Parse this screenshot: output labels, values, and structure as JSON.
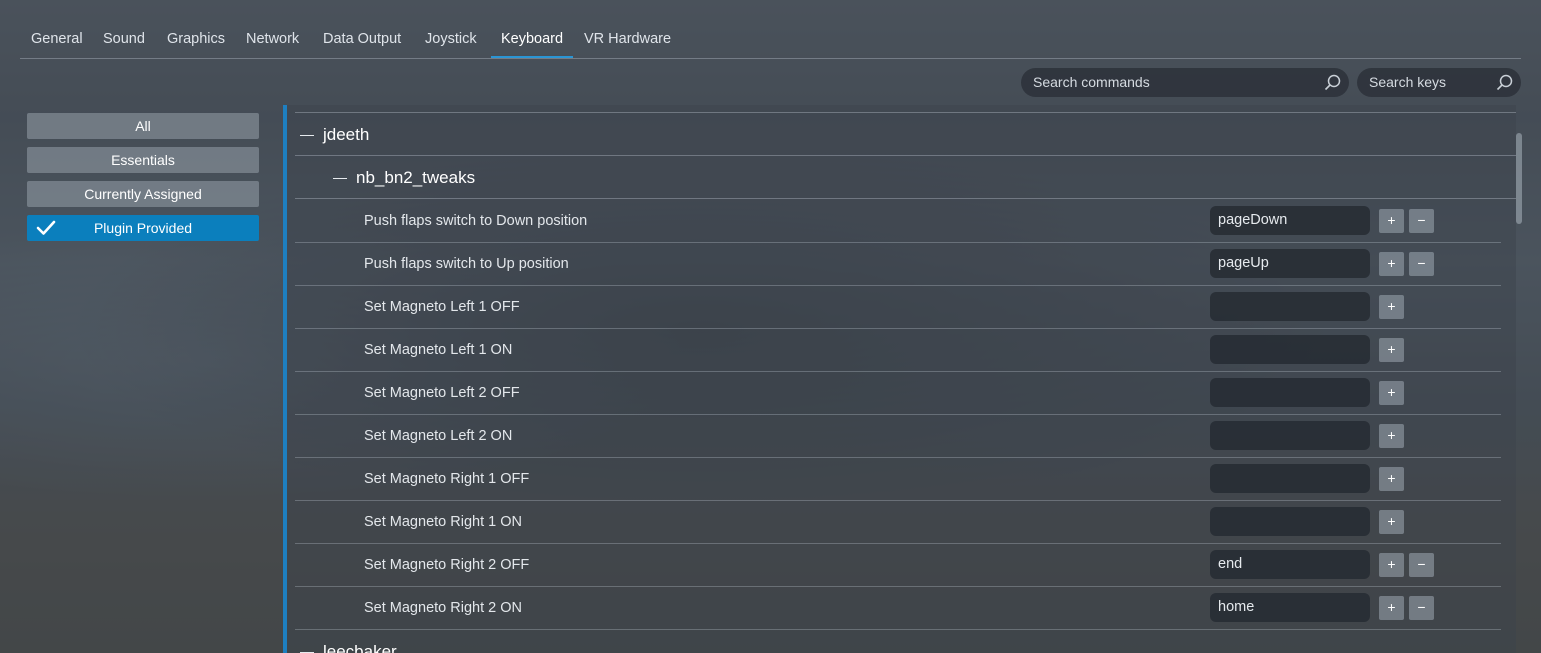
{
  "tabs": [
    {
      "label": "General"
    },
    {
      "label": "Sound"
    },
    {
      "label": "Graphics"
    },
    {
      "label": "Network"
    },
    {
      "label": "Data Output"
    },
    {
      "label": "Joystick"
    },
    {
      "label": "Keyboard",
      "active": true
    },
    {
      "label": "VR Hardware"
    }
  ],
  "search": {
    "commands_placeholder": "Search commands",
    "keys_placeholder": "Search keys"
  },
  "filters": [
    {
      "label": "All"
    },
    {
      "label": "Essentials"
    },
    {
      "label": "Currently Assigned"
    },
    {
      "label": "Plugin Provided",
      "active": true
    }
  ],
  "groups": {
    "jdeeth": "jdeeth",
    "nb_bn2_tweaks": "nb_bn2_tweaks",
    "leecbaker": "leecbaker"
  },
  "commands": [
    {
      "label": "Push flaps switch to Down position",
      "key": "pageDown"
    },
    {
      "label": "Push flaps switch to Up position",
      "key": "pageUp"
    },
    {
      "label": "Set Magneto Left 1 OFF",
      "key": ""
    },
    {
      "label": "Set Magneto Left 1 ON",
      "key": ""
    },
    {
      "label": "Set Magneto Left 2 OFF",
      "key": ""
    },
    {
      "label": "Set Magneto Left 2 ON",
      "key": ""
    },
    {
      "label": "Set Magneto Right 1 OFF",
      "key": ""
    },
    {
      "label": "Set Magneto Right 1 ON",
      "key": ""
    },
    {
      "label": "Set Magneto Right 2 OFF",
      "key": "end"
    },
    {
      "label": "Set Magneto Right 2 ON",
      "key": "home"
    }
  ],
  "buttons": {
    "add": "+",
    "remove": "−"
  },
  "colors": {
    "accent": "#0b7fbd",
    "tab_underline": "#2a95d4",
    "list_border": "#1e7fc0"
  }
}
